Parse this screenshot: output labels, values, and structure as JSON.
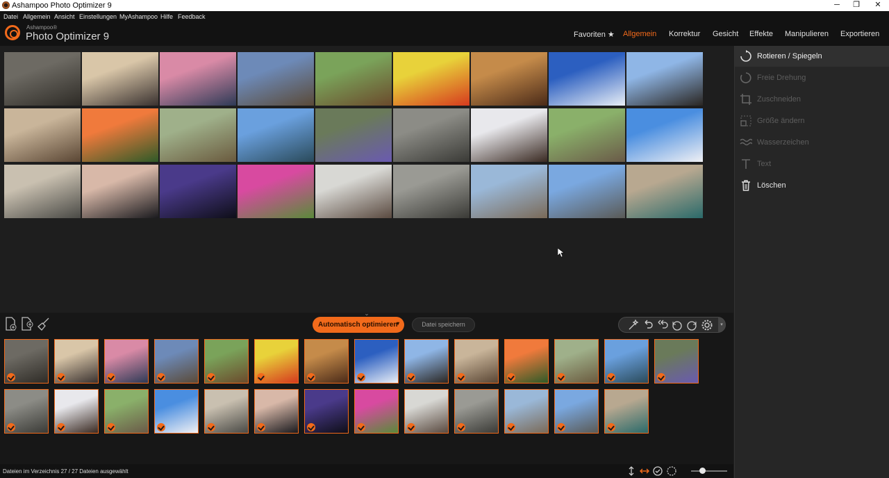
{
  "window": {
    "title": "Ashampoo Photo Optimizer 9",
    "controls": [
      "─",
      "❐",
      "✕"
    ]
  },
  "menu": [
    "Datei",
    "Allgemein",
    "Ansicht",
    "Einstellungen",
    "MyAshampoo",
    "Hilfe",
    "Feedback"
  ],
  "brand": {
    "small": "Ashampoo®",
    "name": "Photo Optimizer 9"
  },
  "nav": [
    {
      "label": "Favoriten ★",
      "active": false
    },
    {
      "label": "Allgemein",
      "active": true
    },
    {
      "label": "Korrektur",
      "active": false
    },
    {
      "label": "Gesicht",
      "active": false
    },
    {
      "label": "Effekte",
      "active": false
    },
    {
      "label": "Manipulieren",
      "active": false
    },
    {
      "label": "Exportieren",
      "active": false
    }
  ],
  "colors": {
    "accent": "#f26a1b",
    "background": "#1e1e1e",
    "panel": "#262626"
  },
  "photos": [
    {
      "name": "temple-ruins",
      "c1": "#6d6a63",
      "c2": "#2e2b26"
    },
    {
      "name": "cat-on-steps",
      "c1": "#d9c6a8",
      "c2": "#3a3230"
    },
    {
      "name": "sunset-lake",
      "c1": "#d98aa6",
      "c2": "#2d3a56"
    },
    {
      "name": "tree-mountain",
      "c1": "#6d8ab8",
      "c2": "#5a4a38"
    },
    {
      "name": "horse-fence",
      "c1": "#7aa35a",
      "c2": "#6b4a2c"
    },
    {
      "name": "yellow-butterfly",
      "c1": "#e8d23a",
      "c2": "#d63a1e"
    },
    {
      "name": "dried-fruits",
      "c1": "#c58b4a",
      "c2": "#4a2a18"
    },
    {
      "name": "heron-roof",
      "c1": "#2c5fc0",
      "c2": "#e8eef6"
    },
    {
      "name": "old-houses",
      "c1": "#8fb6e6",
      "c2": "#2a2622"
    },
    {
      "name": "houses-sepia",
      "c1": "#c9b59a",
      "c2": "#5a4634"
    },
    {
      "name": "orange-flowers",
      "c1": "#f07a3c",
      "c2": "#2e5a28"
    },
    {
      "name": "marmot",
      "c1": "#9fb08a",
      "c2": "#6a5a3e"
    },
    {
      "name": "mountain-lake",
      "c1": "#6aa0de",
      "c2": "#2a4a5a"
    },
    {
      "name": "village-flowers",
      "c1": "#6a7a5a",
      "c2": "#6a5ab0"
    },
    {
      "name": "monkeys",
      "c1": "#8c8c86",
      "c2": "#3a3a36"
    },
    {
      "name": "mules-street",
      "c1": "#e8e8ec",
      "c2": "#3a2a22"
    },
    {
      "name": "park-bench",
      "c1": "#8ab06a",
      "c2": "#6a5a48"
    },
    {
      "name": "blue-dome",
      "c1": "#4a8ee0",
      "c2": "#f0f0f4"
    },
    {
      "name": "colonial-building",
      "c1": "#c9c0b0",
      "c2": "#4a4a46"
    },
    {
      "name": "palm-silhouettes",
      "c1": "#d8b8a8",
      "c2": "#1a1a1e"
    },
    {
      "name": "towers-night",
      "c1": "#4a3a8a",
      "c2": "#0e0e18"
    },
    {
      "name": "pink-window",
      "c1": "#d84aa0",
      "c2": "#5a8a3a"
    },
    {
      "name": "sea-lions",
      "c1": "#d8d8d4",
      "c2": "#5a4a40"
    },
    {
      "name": "stone-face",
      "c1": "#9a9a94",
      "c2": "#3a3a36"
    },
    {
      "name": "desert-houses",
      "c1": "#9ab8d8",
      "c2": "#7a6a58"
    },
    {
      "name": "harbor-view",
      "c1": "#7aa8e0",
      "c2": "#5a5a56"
    },
    {
      "name": "venice-canal",
      "c1": "#b8a890",
      "c2": "#2a6a6a"
    }
  ],
  "tools": [
    {
      "label": "Rotieren / Spiegeln",
      "active": true
    },
    {
      "label": "Freie Drehung",
      "active": false
    },
    {
      "label": "Zuschneiden",
      "active": false
    },
    {
      "label": "Größe ändern",
      "active": false
    },
    {
      "label": "Wasserzeichen",
      "active": false
    },
    {
      "label": "Text",
      "active": false
    },
    {
      "label": "Löschen",
      "active": false
    }
  ],
  "actions": {
    "auto_optimize": "Automatisch optimieren",
    "save_file": "Datei speichern"
  },
  "status": {
    "text": "Dateien im Verzeichnis 27 / 27 Dateien ausgewählt",
    "selected": 27,
    "total": 27
  },
  "zoom_level": 0.3
}
